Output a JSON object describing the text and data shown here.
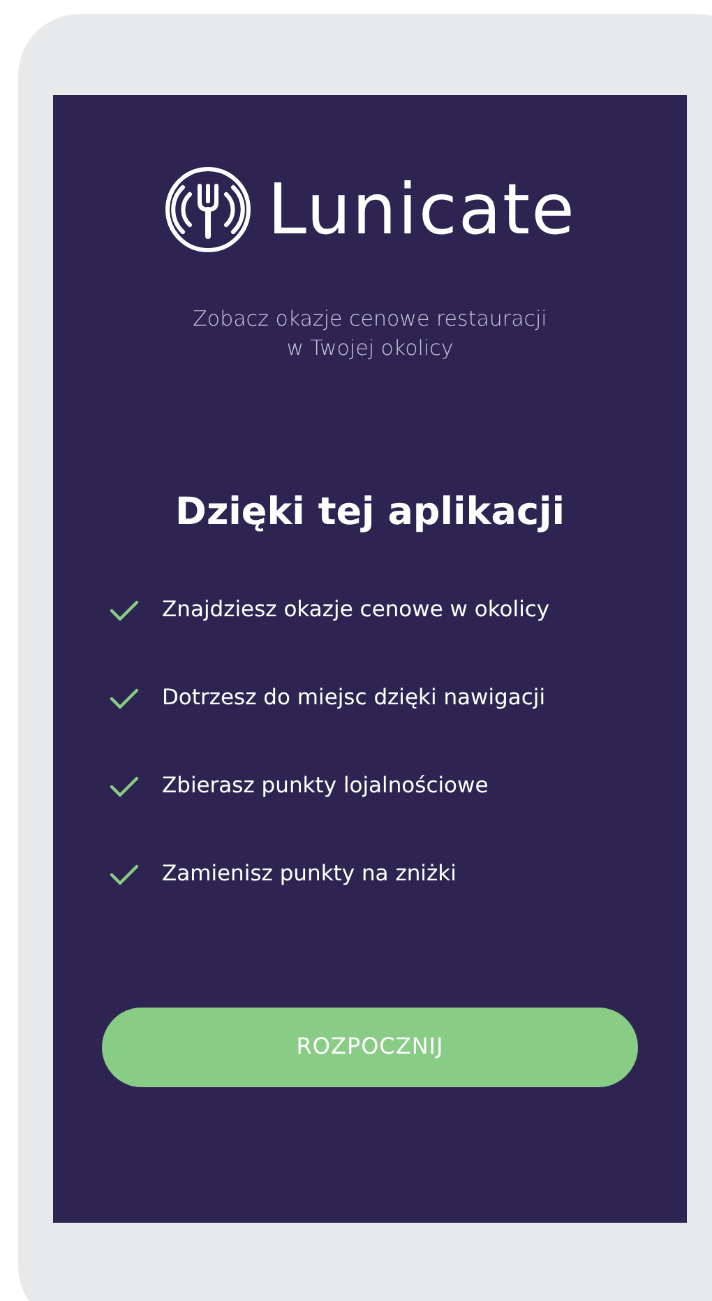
{
  "logo": {
    "text": "Lunicate"
  },
  "subtitle": "Zobacz okazje cenowe restauracji\nw Twojej okolicy",
  "heading": "Dzięki tej aplikacji",
  "features": [
    {
      "text": "Znajdziesz okazje cenowe w okolicy",
      "checked": true
    },
    {
      "text": "Dotrzesz do miejsc dzięki nawigacji",
      "checked": true
    },
    {
      "text": "Zbierasz punkty lojalnościowe",
      "checked": true
    },
    {
      "text": "Zamienisz punkty na zniżki",
      "checked": true
    }
  ],
  "button": {
    "label": "ROZPOCZNIJ"
  }
}
